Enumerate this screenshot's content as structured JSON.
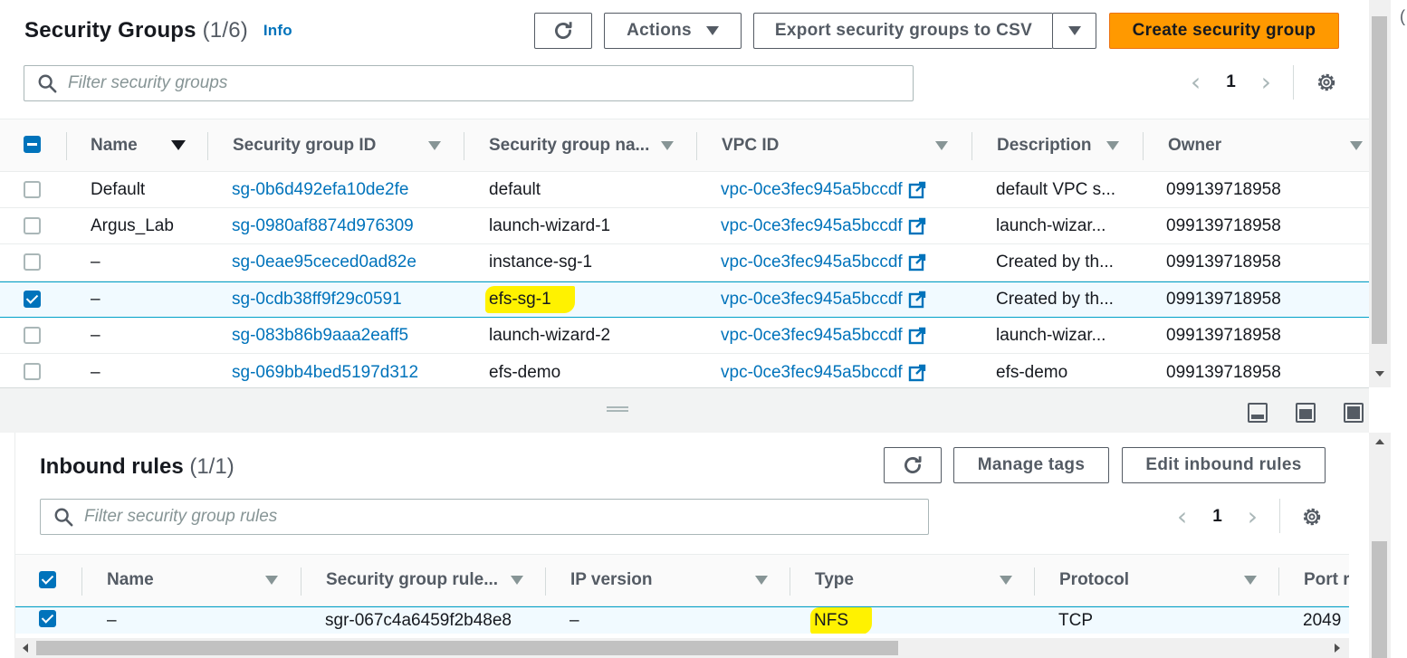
{
  "security_groups": {
    "title": "Security Groups",
    "count": "(1/6)",
    "info_label": "Info",
    "actions_label": "Actions",
    "export_label": "Export security groups to CSV",
    "create_label": "Create security group",
    "search_placeholder": "Filter security groups",
    "page": "1",
    "columns": [
      "Name",
      "Security group ID",
      "Security group na...",
      "VPC ID",
      "Description",
      "Owner"
    ],
    "rows": [
      {
        "name": "Default",
        "sg_id": "sg-0b6d492efa10de2fe",
        "sg_name": "default",
        "vpc_id": "vpc-0ce3fec945a5bccdf",
        "description": "default VPC s...",
        "owner": "099139718958",
        "selected": false
      },
      {
        "name": "Argus_Lab",
        "sg_id": "sg-0980af8874d976309",
        "sg_name": "launch-wizard-1",
        "vpc_id": "vpc-0ce3fec945a5bccdf",
        "description": "launch-wizar...",
        "owner": "099139718958",
        "selected": false
      },
      {
        "name": "–",
        "sg_id": "sg-0eae95ceced0ad82e",
        "sg_name": "instance-sg-1",
        "vpc_id": "vpc-0ce3fec945a5bccdf",
        "description": "Created by th...",
        "owner": "099139718958",
        "selected": false
      },
      {
        "name": "–",
        "sg_id": "sg-0cdb38ff9f29c0591",
        "sg_name": "efs-sg-1",
        "vpc_id": "vpc-0ce3fec945a5bccdf",
        "description": "Created by th...",
        "owner": "099139718958",
        "selected": true
      },
      {
        "name": "–",
        "sg_id": "sg-083b86b9aaa2eaff5",
        "sg_name": "launch-wizard-2",
        "vpc_id": "vpc-0ce3fec945a5bccdf",
        "description": "launch-wizar...",
        "owner": "099139718958",
        "selected": false
      },
      {
        "name": "–",
        "sg_id": "sg-069bb4bed5197d312",
        "sg_name": "efs-demo",
        "vpc_id": "vpc-0ce3fec945a5bccdf",
        "description": "efs-demo",
        "owner": "099139718958",
        "selected": false
      }
    ]
  },
  "inbound_rules": {
    "title": "Inbound rules",
    "count": "(1/1)",
    "manage_tags_label": "Manage tags",
    "edit_label": "Edit inbound rules",
    "search_placeholder": "Filter security group rules",
    "page": "1",
    "columns": [
      "Name",
      "Security group rule...",
      "IP version",
      "Type",
      "Protocol",
      "Port r"
    ],
    "rows": [
      {
        "name": "–",
        "rule_id": "sgr-067c4a6459f2b48e8",
        "ip_version": "–",
        "type": "NFS",
        "protocol": "TCP",
        "port_range": "2049"
      }
    ]
  },
  "colors": {
    "primary_button": "#ff9900",
    "link": "#0073bb",
    "highlight": "#fff200",
    "selected_row": "#f1faff"
  },
  "icons": [
    "refresh-icon",
    "caret-down-icon",
    "search-icon",
    "gear-icon",
    "external-link-icon",
    "chevron-left-icon",
    "chevron-right-icon",
    "sort-icon",
    "layout-bottom-icon",
    "layout-side-icon",
    "layout-full-icon"
  ]
}
